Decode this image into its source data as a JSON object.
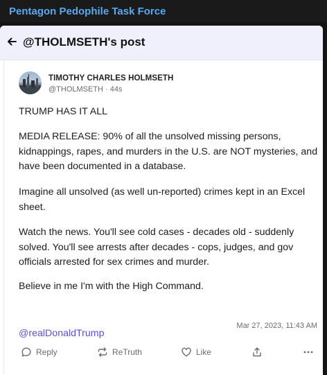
{
  "window": {
    "title": "Pentagon Pedophile Task Force"
  },
  "post_header": {
    "title": "@THOLMSETH's post",
    "back_icon": "arrow-left-icon"
  },
  "author": {
    "display_name": "TIMOTHY CHARLES HOLMSETH",
    "meta": "@THOLMSETH · 44s"
  },
  "post": {
    "paragraphs": [
      "TRUMP HAS IT ALL",
      "MEDIA RELEASE: 90% of all the unsolved missing persons, kidnappings, rapes, and murders in the U.S. are NOT mysteries, and have been documented in a database.",
      "Imagine all unsolved (as well un-reported) crimes kept in an Excel sheet.",
      "Watch the news. You'll see cold cases - decades old - suddenly solved. You'll see arrests after decades - cops, judges, and gov officials arrested for sex crimes and murder.",
      "Believe in me I'm with the High Command."
    ],
    "mention": "@realDonaldTrump",
    "timestamp": "Mar 27, 2023, 11:43 AM"
  },
  "actions": {
    "reply": {
      "label": "Reply",
      "icon": "speech-bubble-icon"
    },
    "retruth": {
      "label": "ReTruth",
      "icon": "repost-arrows-icon"
    },
    "like": {
      "label": "Like",
      "icon": "heart-icon"
    },
    "share": {
      "icon": "share-icon"
    },
    "more": {
      "icon": "more-dots-icon"
    }
  },
  "colors": {
    "window_title": "#5aa9f0",
    "header_bg": "#f0effc",
    "mention": "#5b4fcf"
  }
}
